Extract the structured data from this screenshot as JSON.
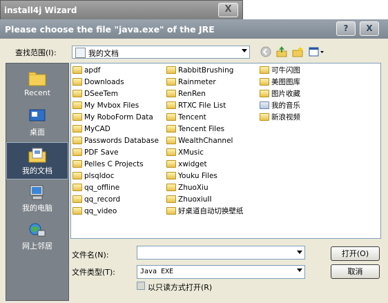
{
  "back_window": {
    "title": "install4j Wizard",
    "close": "X"
  },
  "dialog": {
    "title": "Please choose the file \"java.exe\" of the JRE",
    "help": "?",
    "close": "X",
    "lookin_label": "查找范围(I):",
    "lookin_value": "我的文档",
    "places": [
      {
        "label": "Recent",
        "icon": "recent-icon"
      },
      {
        "label": "桌面",
        "icon": "desktop-icon"
      },
      {
        "label": "我的文档",
        "icon": "my-documents-icon",
        "selected": true
      },
      {
        "label": "我的电脑",
        "icon": "my-computer-icon"
      },
      {
        "label": "网上邻居",
        "icon": "network-icon"
      }
    ],
    "files_col1": [
      "apdf",
      "Downloads",
      "DSeeTem",
      "My Mvbox Files",
      "My RoboForm Data",
      "MyCAD",
      "Passwords Database",
      "PDF Save",
      "Pelles C Projects",
      "plsqldoc",
      "qq_offline",
      "qq_record",
      "qq_video"
    ],
    "files_col2": [
      "RabbitBrushing",
      "Rainmeter",
      "RenRen",
      "RTXC File List",
      "Tencent",
      "Tencent Files",
      "WealthChannel",
      "XMusic",
      "xwidget",
      "Youku Files",
      "ZhuoXiu",
      "ZhuoxiuII",
      "好桌道自动切换壁纸"
    ],
    "files_col3": [
      "可牛闪图",
      "美图图库",
      "图片收藏",
      "我的音乐",
      "新浪视频"
    ],
    "filename_label": "文件名(N):",
    "filename_value": "",
    "filetype_label": "文件类型(T):",
    "filetype_value": "Java EXE",
    "readonly_label": "以只读方式打开(R)",
    "open_button": "打开(O)",
    "cancel_button": "取消"
  }
}
